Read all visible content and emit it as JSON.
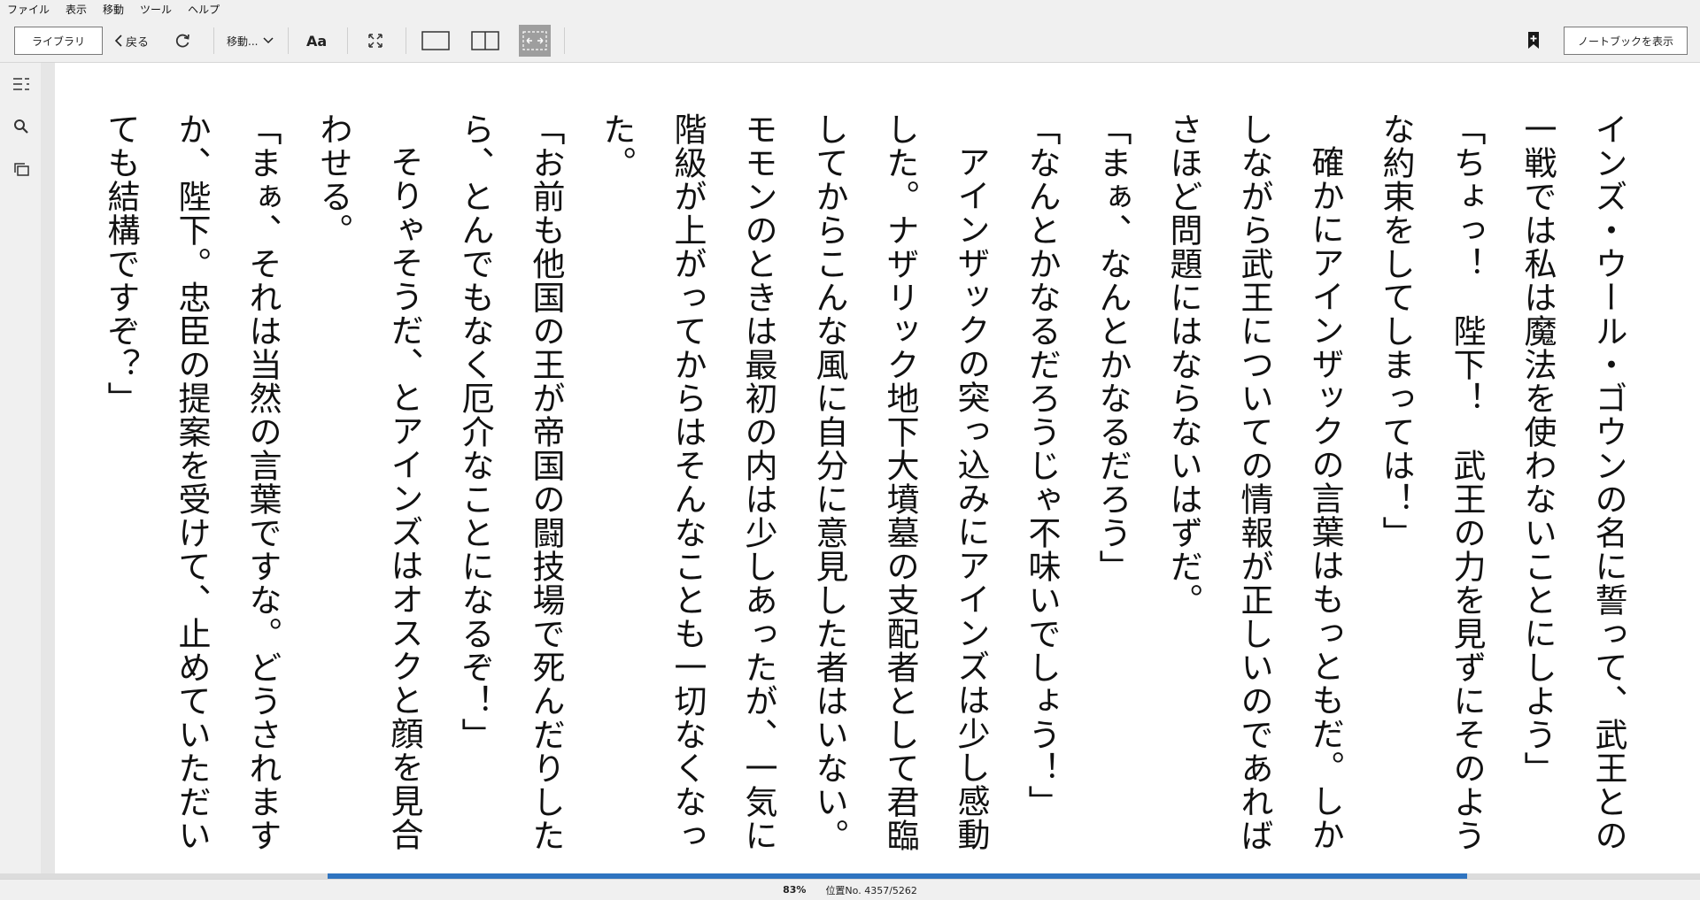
{
  "menu": [
    "ファイル",
    "表示",
    "移動",
    "ツール",
    "ヘルプ"
  ],
  "toolbar": {
    "library_label": "ライブラリ",
    "back_label": "戻る",
    "goto_label": "移動...",
    "font_label": "Aa",
    "notebook_label": "ノートブックを表示"
  },
  "book": {
    "paragraphs": [
      {
        "text": "インズ・ウール・ゴウンの名に誓って、武王との一戦では私は魔法を使わないことにしよう」",
        "indent": false
      },
      {
        "text": "「ちょっ！　陛下！　武王の力を見ずにそのような約束をしてしまっては！」",
        "indent": false
      },
      {
        "text": "確かにアインザックの言葉はもっともだ。しかしながら武王についての情報が正しいのであればさほど問題にはならないはずだ。",
        "indent": true
      },
      {
        "text": "「まぁ、なんとかなるだろう」",
        "indent": false
      },
      {
        "text": "「なんとかなるだろうじゃ不味いでしょう！」",
        "indent": false
      },
      {
        "text": "アインザックの突っ込みにアインズは少し感動した。ナザリック地下大墳墓の支配者として君臨してからこんな風に自分に意見した者はいない。モモンのときは最初の内は少しあったが、一気に階級が上がってからはそんなことも一切なくなった。",
        "indent": true
      },
      {
        "text": "「お前も他国の王が帝国の闘技場で死んだりしたら、とんでもなく厄介なことになるぞ！」",
        "indent": false
      },
      {
        "text": "そりゃそうだ、とアインズはオスクと顔を見合わせる。",
        "indent": true
      },
      {
        "text": "「まぁ、それは当然の言葉ですな。どうされますか、陛下。忠臣の提案を受けて、止めていただいても結構ですぞ？」",
        "indent": false
      }
    ]
  },
  "status": {
    "percent": "83%",
    "progress": 0.83,
    "location": "位置No. 4357/5262"
  }
}
